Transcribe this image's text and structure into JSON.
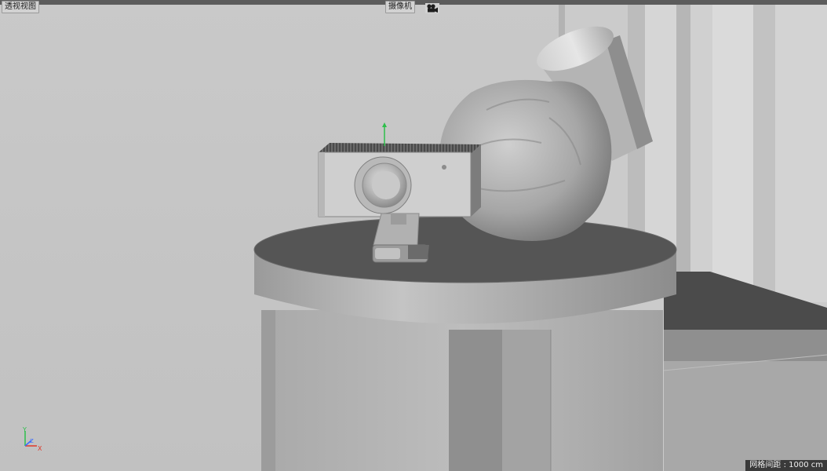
{
  "viewport": {
    "view_name": "透视视图",
    "camera_name": "摄像机",
    "grid_spacing": "网格间距 : 1000 cm"
  },
  "axes": {
    "y": "Y",
    "z": "Z",
    "x": "X"
  },
  "colors": {
    "y_axis": "#2dbf4a",
    "z_axis": "#3b6cff",
    "x_axis": "#e0392b",
    "background": "#c6c6c6"
  },
  "icons": [
    "camera-icon"
  ]
}
